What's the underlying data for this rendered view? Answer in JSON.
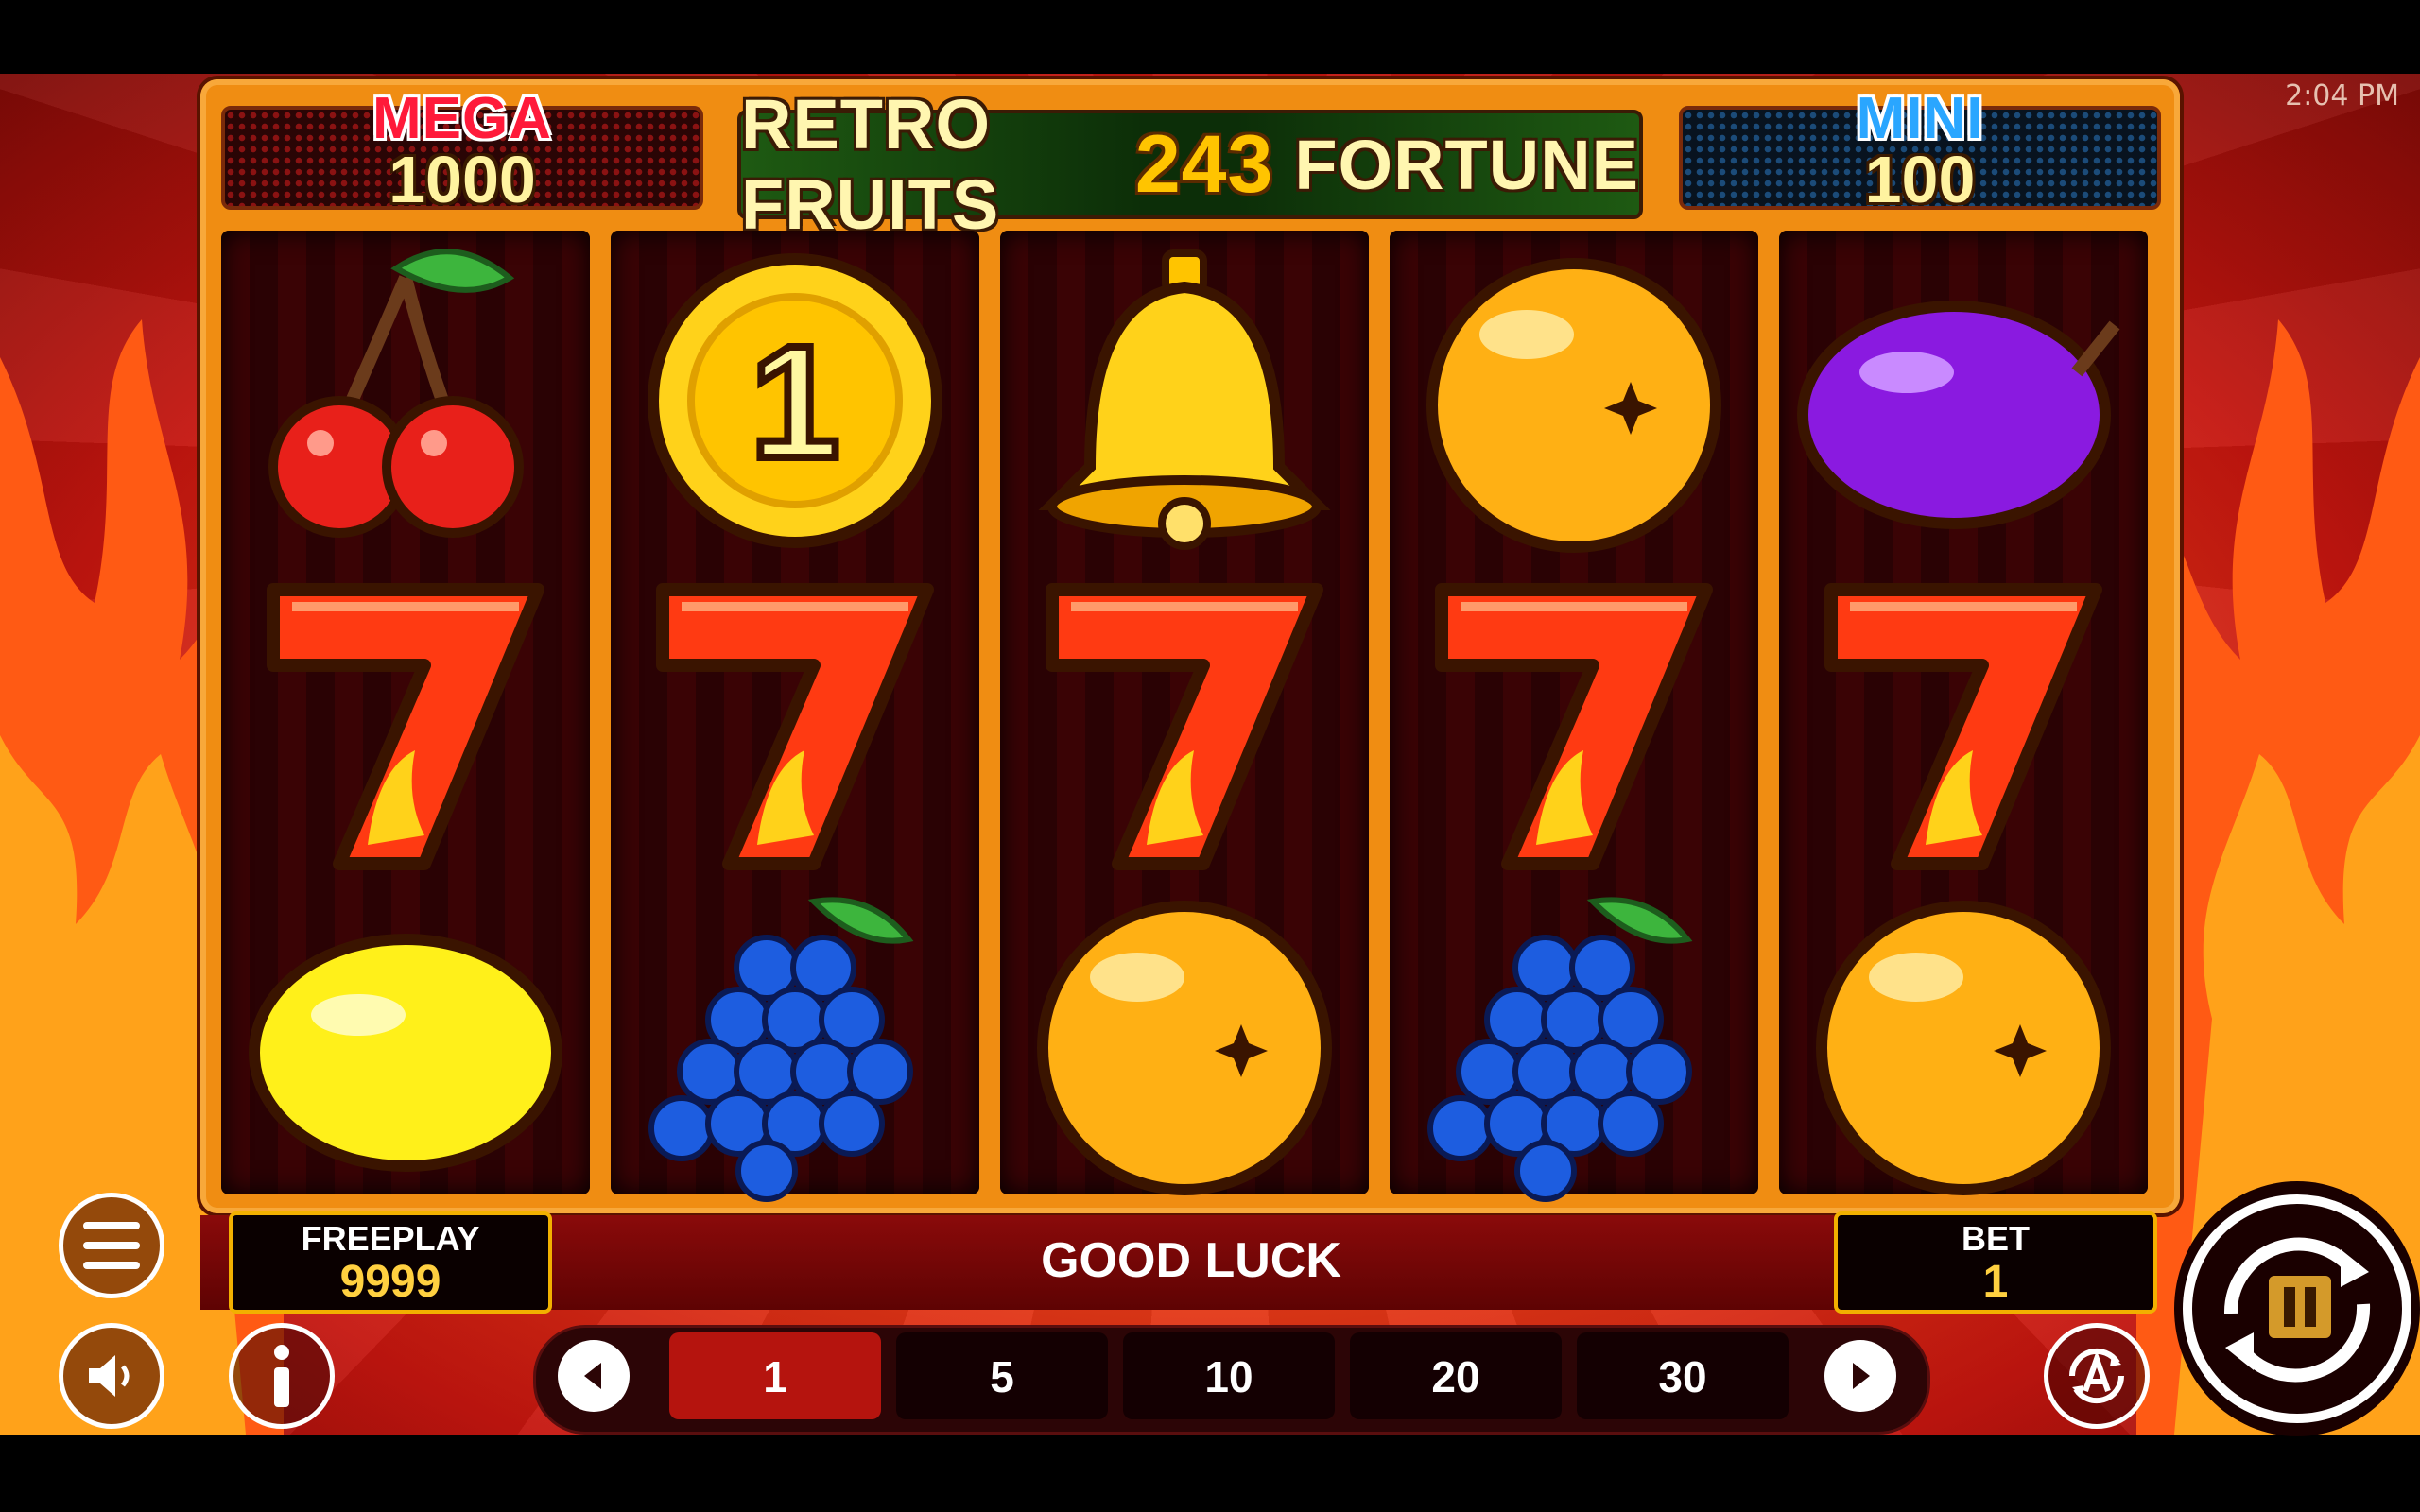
{
  "status_bar": {
    "time": "2:04 PM"
  },
  "jackpots": {
    "mega": {
      "label": "MEGA",
      "value": "1000"
    },
    "mini": {
      "label": "MINI",
      "value": "100"
    }
  },
  "title": {
    "part1": "RETRO FRUITS",
    "number": "243",
    "part2": "FORTUNE"
  },
  "reels": [
    [
      "cherry",
      "seven",
      "lemon"
    ],
    [
      "coin-1",
      "seven",
      "grapes"
    ],
    [
      "bell",
      "seven",
      "orange"
    ],
    [
      "orange",
      "seven",
      "grapes"
    ],
    [
      "plum",
      "seven",
      "orange"
    ]
  ],
  "coin_label": "1",
  "freeplay": {
    "label": "FREEPLAY",
    "value": "9999"
  },
  "message": "GOOD LUCK",
  "bet": {
    "label": "BET",
    "value": "1"
  },
  "bet_options": [
    "1",
    "5",
    "10",
    "20",
    "30"
  ],
  "selected_bet": "1",
  "icons": [
    "menu-icon",
    "sound-icon",
    "info-icon",
    "prev-arrow-icon",
    "next-arrow-icon",
    "autoplay-icon",
    "spin-icon",
    "pause-icon"
  ],
  "colors": {
    "frame": "#f08d12",
    "reel_bg": "#3a0305",
    "jackpot_value": "#fff3a0",
    "selected_bet": "#b5140e",
    "box_border": "#f2b000"
  }
}
